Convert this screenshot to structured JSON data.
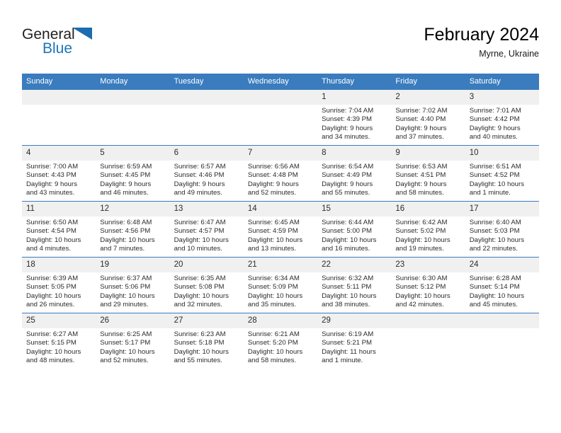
{
  "brand": {
    "name_part1": "General",
    "name_part2": "Blue",
    "triangle_color": "#1b6cb0",
    "blue_color": "#1b75bb"
  },
  "header": {
    "title": "February 2024",
    "location": "Myrne, Ukraine"
  },
  "theme": {
    "header_blue": "#3a7cbe",
    "daynum_band": "#f0f0f0",
    "text": "#2b2b2b"
  },
  "columns": [
    "Sunday",
    "Monday",
    "Tuesday",
    "Wednesday",
    "Thursday",
    "Friday",
    "Saturday"
  ],
  "weeks": [
    [
      {
        "day": "",
        "empty": true
      },
      {
        "day": "",
        "empty": true
      },
      {
        "day": "",
        "empty": true
      },
      {
        "day": "",
        "empty": true
      },
      {
        "day": "1",
        "sunrise": "Sunrise: 7:04 AM",
        "sunset": "Sunset: 4:39 PM",
        "daylight1": "Daylight: 9 hours",
        "daylight2": "and 34 minutes."
      },
      {
        "day": "2",
        "sunrise": "Sunrise: 7:02 AM",
        "sunset": "Sunset: 4:40 PM",
        "daylight1": "Daylight: 9 hours",
        "daylight2": "and 37 minutes."
      },
      {
        "day": "3",
        "sunrise": "Sunrise: 7:01 AM",
        "sunset": "Sunset: 4:42 PM",
        "daylight1": "Daylight: 9 hours",
        "daylight2": "and 40 minutes."
      }
    ],
    [
      {
        "day": "4",
        "sunrise": "Sunrise: 7:00 AM",
        "sunset": "Sunset: 4:43 PM",
        "daylight1": "Daylight: 9 hours",
        "daylight2": "and 43 minutes."
      },
      {
        "day": "5",
        "sunrise": "Sunrise: 6:59 AM",
        "sunset": "Sunset: 4:45 PM",
        "daylight1": "Daylight: 9 hours",
        "daylight2": "and 46 minutes."
      },
      {
        "day": "6",
        "sunrise": "Sunrise: 6:57 AM",
        "sunset": "Sunset: 4:46 PM",
        "daylight1": "Daylight: 9 hours",
        "daylight2": "and 49 minutes."
      },
      {
        "day": "7",
        "sunrise": "Sunrise: 6:56 AM",
        "sunset": "Sunset: 4:48 PM",
        "daylight1": "Daylight: 9 hours",
        "daylight2": "and 52 minutes."
      },
      {
        "day": "8",
        "sunrise": "Sunrise: 6:54 AM",
        "sunset": "Sunset: 4:49 PM",
        "daylight1": "Daylight: 9 hours",
        "daylight2": "and 55 minutes."
      },
      {
        "day": "9",
        "sunrise": "Sunrise: 6:53 AM",
        "sunset": "Sunset: 4:51 PM",
        "daylight1": "Daylight: 9 hours",
        "daylight2": "and 58 minutes."
      },
      {
        "day": "10",
        "sunrise": "Sunrise: 6:51 AM",
        "sunset": "Sunset: 4:52 PM",
        "daylight1": "Daylight: 10 hours",
        "daylight2": "and 1 minute."
      }
    ],
    [
      {
        "day": "11",
        "sunrise": "Sunrise: 6:50 AM",
        "sunset": "Sunset: 4:54 PM",
        "daylight1": "Daylight: 10 hours",
        "daylight2": "and 4 minutes."
      },
      {
        "day": "12",
        "sunrise": "Sunrise: 6:48 AM",
        "sunset": "Sunset: 4:56 PM",
        "daylight1": "Daylight: 10 hours",
        "daylight2": "and 7 minutes."
      },
      {
        "day": "13",
        "sunrise": "Sunrise: 6:47 AM",
        "sunset": "Sunset: 4:57 PM",
        "daylight1": "Daylight: 10 hours",
        "daylight2": "and 10 minutes."
      },
      {
        "day": "14",
        "sunrise": "Sunrise: 6:45 AM",
        "sunset": "Sunset: 4:59 PM",
        "daylight1": "Daylight: 10 hours",
        "daylight2": "and 13 minutes."
      },
      {
        "day": "15",
        "sunrise": "Sunrise: 6:44 AM",
        "sunset": "Sunset: 5:00 PM",
        "daylight1": "Daylight: 10 hours",
        "daylight2": "and 16 minutes."
      },
      {
        "day": "16",
        "sunrise": "Sunrise: 6:42 AM",
        "sunset": "Sunset: 5:02 PM",
        "daylight1": "Daylight: 10 hours",
        "daylight2": "and 19 minutes."
      },
      {
        "day": "17",
        "sunrise": "Sunrise: 6:40 AM",
        "sunset": "Sunset: 5:03 PM",
        "daylight1": "Daylight: 10 hours",
        "daylight2": "and 22 minutes."
      }
    ],
    [
      {
        "day": "18",
        "sunrise": "Sunrise: 6:39 AM",
        "sunset": "Sunset: 5:05 PM",
        "daylight1": "Daylight: 10 hours",
        "daylight2": "and 26 minutes."
      },
      {
        "day": "19",
        "sunrise": "Sunrise: 6:37 AM",
        "sunset": "Sunset: 5:06 PM",
        "daylight1": "Daylight: 10 hours",
        "daylight2": "and 29 minutes."
      },
      {
        "day": "20",
        "sunrise": "Sunrise: 6:35 AM",
        "sunset": "Sunset: 5:08 PM",
        "daylight1": "Daylight: 10 hours",
        "daylight2": "and 32 minutes."
      },
      {
        "day": "21",
        "sunrise": "Sunrise: 6:34 AM",
        "sunset": "Sunset: 5:09 PM",
        "daylight1": "Daylight: 10 hours",
        "daylight2": "and 35 minutes."
      },
      {
        "day": "22",
        "sunrise": "Sunrise: 6:32 AM",
        "sunset": "Sunset: 5:11 PM",
        "daylight1": "Daylight: 10 hours",
        "daylight2": "and 38 minutes."
      },
      {
        "day": "23",
        "sunrise": "Sunrise: 6:30 AM",
        "sunset": "Sunset: 5:12 PM",
        "daylight1": "Daylight: 10 hours",
        "daylight2": "and 42 minutes."
      },
      {
        "day": "24",
        "sunrise": "Sunrise: 6:28 AM",
        "sunset": "Sunset: 5:14 PM",
        "daylight1": "Daylight: 10 hours",
        "daylight2": "and 45 minutes."
      }
    ],
    [
      {
        "day": "25",
        "sunrise": "Sunrise: 6:27 AM",
        "sunset": "Sunset: 5:15 PM",
        "daylight1": "Daylight: 10 hours",
        "daylight2": "and 48 minutes."
      },
      {
        "day": "26",
        "sunrise": "Sunrise: 6:25 AM",
        "sunset": "Sunset: 5:17 PM",
        "daylight1": "Daylight: 10 hours",
        "daylight2": "and 52 minutes."
      },
      {
        "day": "27",
        "sunrise": "Sunrise: 6:23 AM",
        "sunset": "Sunset: 5:18 PM",
        "daylight1": "Daylight: 10 hours",
        "daylight2": "and 55 minutes."
      },
      {
        "day": "28",
        "sunrise": "Sunrise: 6:21 AM",
        "sunset": "Sunset: 5:20 PM",
        "daylight1": "Daylight: 10 hours",
        "daylight2": "and 58 minutes."
      },
      {
        "day": "29",
        "sunrise": "Sunrise: 6:19 AM",
        "sunset": "Sunset: 5:21 PM",
        "daylight1": "Daylight: 11 hours",
        "daylight2": "and 1 minute."
      },
      {
        "day": "",
        "empty": true
      },
      {
        "day": "",
        "empty": true
      }
    ]
  ]
}
